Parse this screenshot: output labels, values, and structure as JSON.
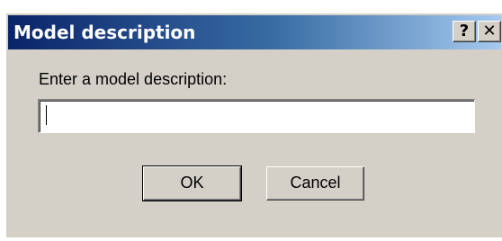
{
  "dialog": {
    "title": "Model description",
    "help_button_label": "?",
    "close_button_label": "✕",
    "prompt_label": "Enter a model description:",
    "input_value": "",
    "ok_label": "OK",
    "cancel_label": "Cancel"
  },
  "colors": {
    "title_bar_start": "#0a246a",
    "title_bar_end": "#a6caf0",
    "dialog_face": "#d4d0c8"
  }
}
